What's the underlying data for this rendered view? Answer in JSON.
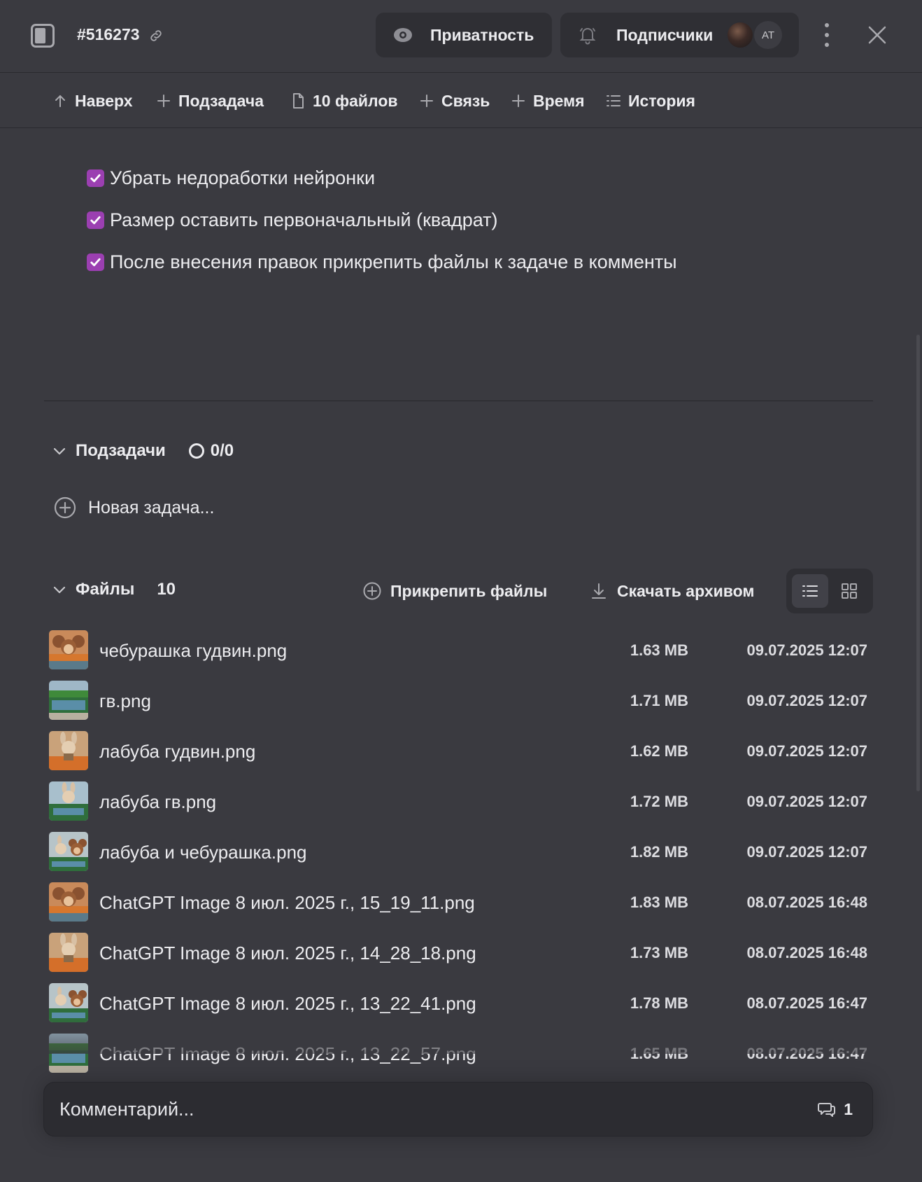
{
  "header": {
    "task_id": "#516273",
    "privacy_label": "Приватность",
    "subscribers_label": "Подписчики",
    "avatar_initials": "AT"
  },
  "toolbar": {
    "up_label": "Наверх",
    "subtask_label": "Подзадача",
    "files_label": "10 файлов",
    "link_label": "Связь",
    "time_label": "Время",
    "history_label": "История"
  },
  "checklist": [
    {
      "text": "Убрать недоработки нейронки",
      "checked": true
    },
    {
      "text": "Размер оставить первоначальный (квадрат)",
      "checked": true
    },
    {
      "text": "После внесения правок прикрепить файлы к задаче в комменты",
      "checked": true
    }
  ],
  "subtasks": {
    "title": "Подзадачи",
    "progress": "0/0",
    "new_task_label": "Новая задача..."
  },
  "files": {
    "title": "Файлы",
    "count": "10",
    "attach_label": "Прикрепить файлы",
    "download_label": "Скачать архивом",
    "items": [
      {
        "name": "чебурашка гудвин.png",
        "size": "1.63 MB",
        "date": "09.07.2025 12:07",
        "thumb": "cheburashka"
      },
      {
        "name": "гв.png",
        "size": "1.71 MB",
        "date": "09.07.2025 12:07",
        "thumb": "store"
      },
      {
        "name": "лабуба гудвин.png",
        "size": "1.62 MB",
        "date": "09.07.2025 12:07",
        "thumb": "labubu"
      },
      {
        "name": "лабуба гв.png",
        "size": "1.72 MB",
        "date": "09.07.2025 12:07",
        "thumb": "labubu-store"
      },
      {
        "name": "лабуба и чебурашка.png",
        "size": "1.82 MB",
        "date": "09.07.2025 12:07",
        "thumb": "both"
      },
      {
        "name": "ChatGPT Image 8 июл. 2025 г., 15_19_11.png",
        "size": "1.83 MB",
        "date": "08.07.2025 16:48",
        "thumb": "cheburashka"
      },
      {
        "name": "ChatGPT Image 8 июл. 2025 г., 14_28_18.png",
        "size": "1.73 MB",
        "date": "08.07.2025 16:48",
        "thumb": "labubu"
      },
      {
        "name": "ChatGPT Image 8 июл. 2025 г., 13_22_41.png",
        "size": "1.78 MB",
        "date": "08.07.2025 16:47",
        "thumb": "both"
      },
      {
        "name": "ChatGPT Image 8 июл. 2025 г., 13_22_57.png",
        "size": "1.65 MB",
        "date": "08.07.2025 16:47",
        "thumb": "store"
      }
    ]
  },
  "comment": {
    "placeholder": "Комментарий...",
    "count": "1"
  },
  "colors": {
    "background": "#3a3a40",
    "panel": "#2f2f34",
    "checkbox": "#9b3fb1",
    "text": "#ececef"
  }
}
